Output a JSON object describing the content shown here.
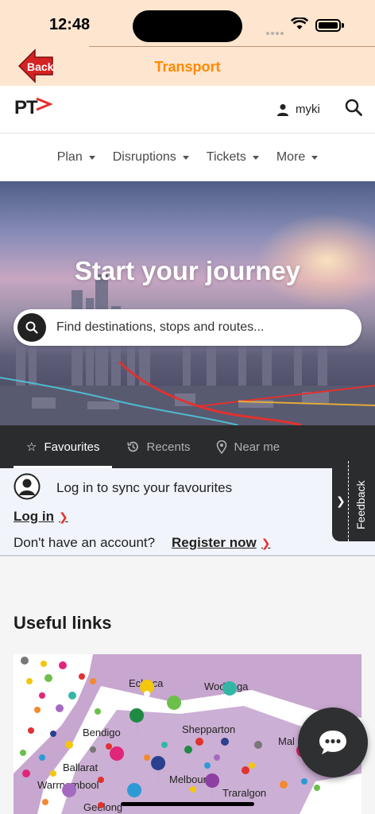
{
  "status_bar": {
    "time": "12:48"
  },
  "app_header": {
    "back_label": "Back",
    "title": "Transport"
  },
  "site_header": {
    "logo": "PT",
    "account_label": "myki"
  },
  "nav": {
    "items": [
      {
        "label": "Plan"
      },
      {
        "label": "Disruptions"
      },
      {
        "label": "Tickets"
      },
      {
        "label": "More"
      }
    ]
  },
  "hero": {
    "title": "Start your journey",
    "search_placeholder": "Find destinations, stops and routes..."
  },
  "tabs": {
    "items": [
      {
        "label": "Favourites",
        "icon": "star-icon",
        "active": true
      },
      {
        "label": "Recents",
        "icon": "history-icon",
        "active": false
      },
      {
        "label": "Near me",
        "icon": "location-pin-icon",
        "active": false
      }
    ]
  },
  "favourites": {
    "sync_text": "Log in to sync your favourites",
    "login_label": "Log in",
    "no_account_text": "Don't have an account?",
    "register_label": "Register now"
  },
  "feedback": {
    "label": "Feedback"
  },
  "useful_links": {
    "title": "Useful links",
    "map_labels": [
      "Echuca",
      "Wodonga",
      "Bendigo",
      "Shepparton",
      "Ballarat",
      "Melbourne",
      "Warrnambool",
      "Traralgon",
      "Geelong",
      "Mal"
    ]
  },
  "colors": {
    "accent": "#ff8a00",
    "brand_red": "#e4312c",
    "dark": "#2b2c2e",
    "header_bg": "#fde5cf"
  }
}
